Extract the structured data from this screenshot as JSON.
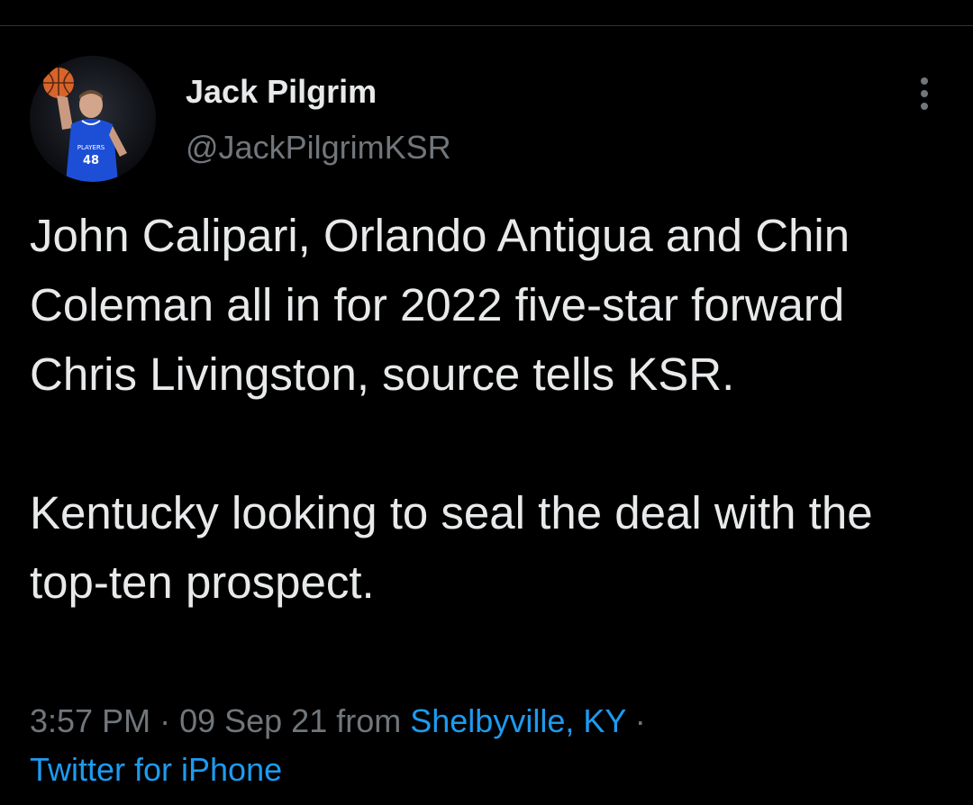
{
  "author": {
    "name": "Jack Pilgrim",
    "handle": "@JackPilgrimKSR",
    "avatar_jersey_text": "PLAYERS 48"
  },
  "tweet": {
    "paragraph1": "John Calipari, Orlando Antigua and Chin Coleman all in for 2022 five-star forward Chris Livingston, source tells KSR.",
    "paragraph2": "Kentucky looking to seal the deal with the top-ten prospect."
  },
  "meta": {
    "time": "3:57 PM",
    "separator1": " · ",
    "date": "09 Sep 21",
    "from_text": " from ",
    "location": "Shelbyville, KY",
    "separator2": " · ",
    "source": "Twitter for iPhone"
  },
  "icons": {
    "more": "more-vertical-icon"
  },
  "colors": {
    "background": "#000000",
    "primary_text": "#e7e9ea",
    "secondary_text": "#71767b",
    "link": "#1d9bf0"
  }
}
